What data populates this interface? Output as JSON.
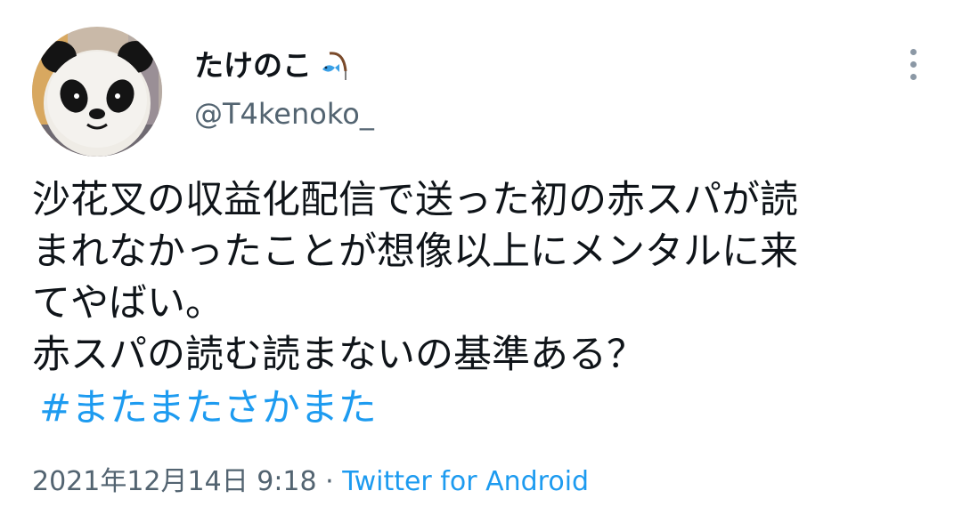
{
  "user": {
    "display_name": "たけのこ",
    "name_emoji_icon": "fishing-pole-emoji-icon",
    "handle": "@T4kenoko_",
    "avatar_icon": "panda-mask-avatar"
  },
  "tweet": {
    "lines": [
      "沙花叉の収益化配信で送った初の赤スパが読",
      "まれなかったことが想像以上にメンタルに来",
      "てやばい。",
      "赤スパの読む読まないの基準ある？"
    ],
    "hashtag": "#またまたさかまた"
  },
  "meta": {
    "timestamp": "2021年12月14日 9:18",
    "separator": " · ",
    "source": "Twitter for Android"
  },
  "menu": {
    "icon": "more-vertical-icon"
  },
  "colors": {
    "text": "#0f1419",
    "secondary": "#536471",
    "link": "#1d9bf0"
  }
}
